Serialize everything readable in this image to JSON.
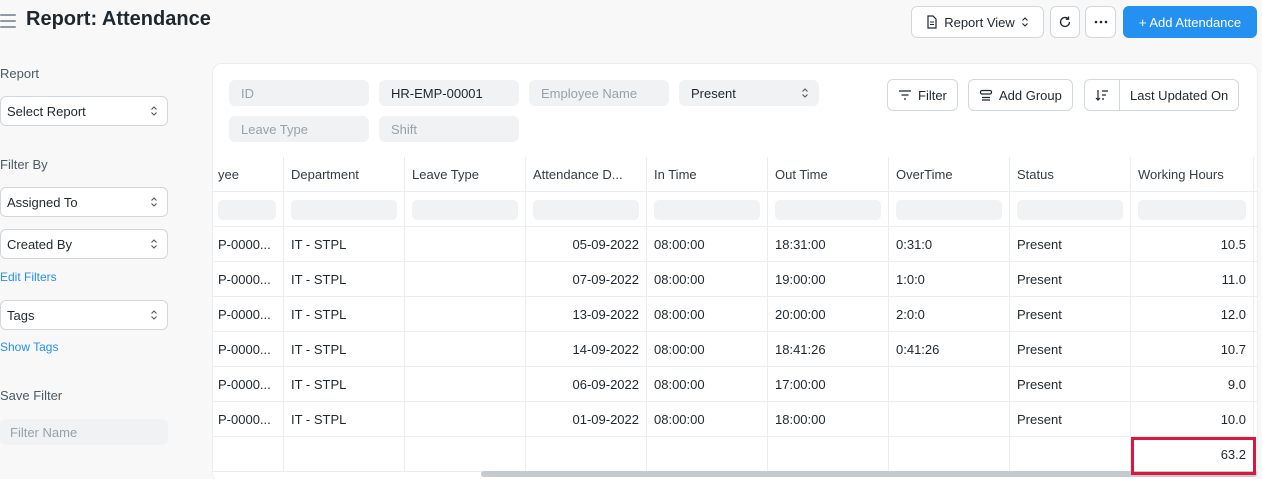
{
  "header": {
    "title": "Report: Attendance",
    "report_view_label": "Report View",
    "add_button_label": "+ Add Attendance"
  },
  "sidebar": {
    "report_heading": "Report",
    "select_report": "Select Report",
    "filter_by_heading": "Filter By",
    "assigned_to": "Assigned To",
    "created_by": "Created By",
    "edit_filters": "Edit Filters",
    "tags": "Tags",
    "show_tags": "Show Tags",
    "save_filter_heading": "Save Filter",
    "filter_name_placeholder": "Filter Name"
  },
  "filters": {
    "id_placeholder": "ID",
    "employee_value": "HR-EMP-00001",
    "employee_name_placeholder": "Employee Name",
    "status_value": "Present",
    "leave_type_placeholder": "Leave Type",
    "shift_placeholder": "Shift"
  },
  "toolbar": {
    "filter_label": "Filter",
    "add_group_label": "Add Group",
    "sort_label": "Last Updated On"
  },
  "table": {
    "columns": [
      "yee",
      "Department",
      "Leave Type",
      "Attendance D...",
      "In Time",
      "Out Time",
      "OverTime",
      "Status",
      "Working Hours"
    ],
    "rows": [
      [
        "P-0000...",
        "IT - STPL",
        "",
        "05-09-2022",
        "08:00:00",
        "18:31:00",
        "0:31:0",
        "Present",
        "10.5"
      ],
      [
        "P-0000...",
        "IT - STPL",
        "",
        "07-09-2022",
        "08:00:00",
        "19:00:00",
        "1:0:0",
        "Present",
        "11.0"
      ],
      [
        "P-0000...",
        "IT - STPL",
        "",
        "13-09-2022",
        "08:00:00",
        "20:00:00",
        "2:0:0",
        "Present",
        "12.0"
      ],
      [
        "P-0000...",
        "IT - STPL",
        "",
        "14-09-2022",
        "08:00:00",
        "18:41:26",
        "0:41:26",
        "Present",
        "10.7"
      ],
      [
        "P-0000...",
        "IT - STPL",
        "",
        "06-09-2022",
        "08:00:00",
        "17:00:00",
        "",
        "Present",
        "9.0"
      ],
      [
        "P-0000...",
        "IT - STPL",
        "",
        "01-09-2022",
        "08:00:00",
        "18:00:00",
        "",
        "Present",
        "10.0"
      ]
    ],
    "total_working_hours": "63.2"
  },
  "colors": {
    "accent": "#2490ef",
    "highlight": "#d7193f"
  }
}
